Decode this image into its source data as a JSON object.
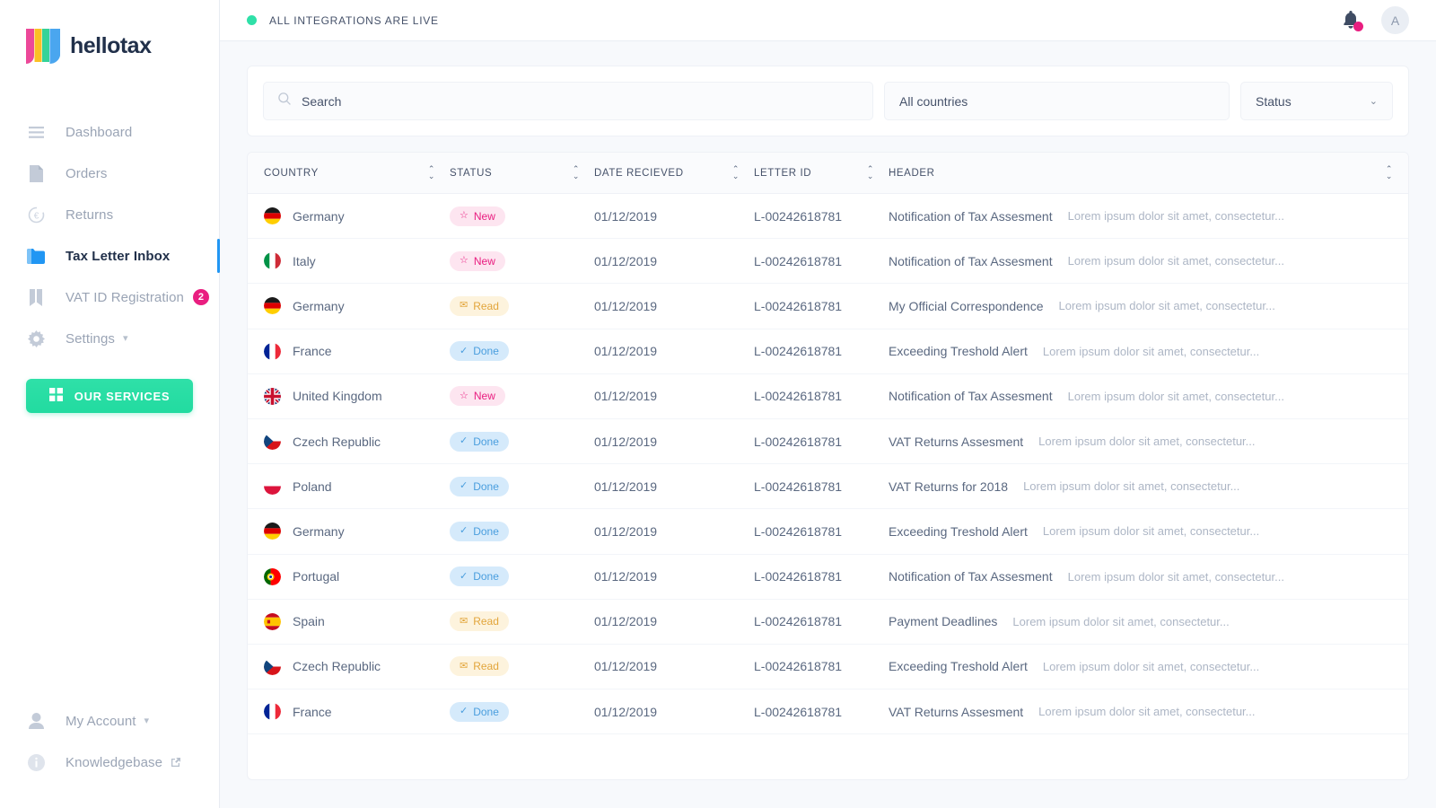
{
  "brand": {
    "name": "hellotax"
  },
  "sidebar": {
    "items": [
      {
        "label": "Dashboard",
        "icon": "menu-icon",
        "active": false
      },
      {
        "label": "Orders",
        "icon": "document-icon",
        "active": false
      },
      {
        "label": "Returns",
        "icon": "euro-refresh-icon",
        "active": false
      },
      {
        "label": "Tax Letter Inbox",
        "icon": "folder-icon",
        "active": true
      },
      {
        "label": "VAT ID Registration",
        "icon": "bookmark-icon",
        "badge": "2",
        "active": false
      },
      {
        "label": "Settings",
        "icon": "gear-icon",
        "chevron": true,
        "active": false
      }
    ],
    "services_button": {
      "label": "OUR SERVICES",
      "icon": "grid-icon"
    },
    "bottom_items": [
      {
        "label": "My Account",
        "icon": "user-icon",
        "chevron": true
      },
      {
        "label": "Knowledgebase",
        "icon": "info-icon",
        "external": true
      }
    ]
  },
  "topbar": {
    "status_text": "ALL INTEGRATIONS ARE LIVE",
    "status_color": "#2fe0a8",
    "notification_icon": "bell-icon",
    "notification_dot_color": "#e91e80",
    "avatar_initial": "A"
  },
  "filters": {
    "search": {
      "placeholder": "Search",
      "value": "",
      "icon": "search-icon"
    },
    "countries": {
      "value": "All countries"
    },
    "status": {
      "value": "Status",
      "icon": "chevron-down-icon"
    }
  },
  "table": {
    "columns": [
      {
        "key": "country",
        "label": "COUNTRY",
        "sortable": true
      },
      {
        "key": "status",
        "label": "STATUS",
        "sortable": true
      },
      {
        "key": "date",
        "label": "DATE RECIEVED",
        "sortable": true
      },
      {
        "key": "letter_id",
        "label": "LETTER ID",
        "sortable": true
      },
      {
        "key": "header",
        "label": "HEADER",
        "sortable": true
      }
    ],
    "rows": [
      {
        "country": "Germany",
        "flag": "de",
        "status": "New",
        "status_icon": "star-icon",
        "date": "01/12/2019",
        "letter_id": "L-00242618781",
        "header": "Notification of Tax Assesment",
        "preview": "Lorem ipsum dolor sit amet, consectetur..."
      },
      {
        "country": "Italy",
        "flag": "it",
        "status": "New",
        "status_icon": "star-icon",
        "date": "01/12/2019",
        "letter_id": "L-00242618781",
        "header": "Notification of Tax Assesment",
        "preview": "Lorem ipsum dolor sit amet, consectetur..."
      },
      {
        "country": "Germany",
        "flag": "de",
        "status": "Read",
        "status_icon": "envelope-icon",
        "date": "01/12/2019",
        "letter_id": "L-00242618781",
        "header": "My Official Correspondence",
        "preview": "Lorem ipsum dolor sit amet, consectetur..."
      },
      {
        "country": "France",
        "flag": "fr",
        "status": "Done",
        "status_icon": "check-icon",
        "date": "01/12/2019",
        "letter_id": "L-00242618781",
        "header": "Exceeding Treshold Alert",
        "preview": "Lorem ipsum dolor sit amet, consectetur..."
      },
      {
        "country": "United Kingdom",
        "flag": "gb",
        "status": "New",
        "status_icon": "star-icon",
        "date": "01/12/2019",
        "letter_id": "L-00242618781",
        "header": "Notification of Tax Assesment",
        "preview": "Lorem ipsum dolor sit amet, consectetur..."
      },
      {
        "country": "Czech Republic",
        "flag": "cz",
        "status": "Done",
        "status_icon": "check-icon",
        "date": "01/12/2019",
        "letter_id": "L-00242618781",
        "header": "VAT Returns Assesment",
        "preview": "Lorem ipsum dolor sit amet, consectetur..."
      },
      {
        "country": "Poland",
        "flag": "pl",
        "status": "Done",
        "status_icon": "check-icon",
        "date": "01/12/2019",
        "letter_id": "L-00242618781",
        "header": "VAT Returns for 2018",
        "preview": "Lorem ipsum dolor sit amet, consectetur..."
      },
      {
        "country": "Germany",
        "flag": "de",
        "status": "Done",
        "status_icon": "check-icon",
        "date": "01/12/2019",
        "letter_id": "L-00242618781",
        "header": "Exceeding Treshold Alert",
        "preview": "Lorem ipsum dolor sit amet, consectetur..."
      },
      {
        "country": "Portugal",
        "flag": "pt",
        "status": "Done",
        "status_icon": "check-icon",
        "date": "01/12/2019",
        "letter_id": "L-00242618781",
        "header": "Notification of Tax Assesment",
        "preview": "Lorem ipsum dolor sit amet, consectetur..."
      },
      {
        "country": "Spain",
        "flag": "es",
        "status": "Read",
        "status_icon": "envelope-icon",
        "date": "01/12/2019",
        "letter_id": "L-00242618781",
        "header": "Payment Deadlines",
        "preview": "Lorem ipsum dolor sit amet, consectetur..."
      },
      {
        "country": "Czech Republic",
        "flag": "cz",
        "status": "Read",
        "status_icon": "envelope-icon",
        "date": "01/12/2019",
        "letter_id": "L-00242618781",
        "header": "Exceeding Treshold Alert",
        "preview": "Lorem ipsum dolor sit amet, consectetur..."
      },
      {
        "country": "France",
        "flag": "fr",
        "status": "Done",
        "status_icon": "check-icon",
        "date": "01/12/2019",
        "letter_id": "L-00242618781",
        "header": "VAT Returns Assesment",
        "preview": "Lorem ipsum dolor sit amet, consectetur..."
      }
    ]
  }
}
